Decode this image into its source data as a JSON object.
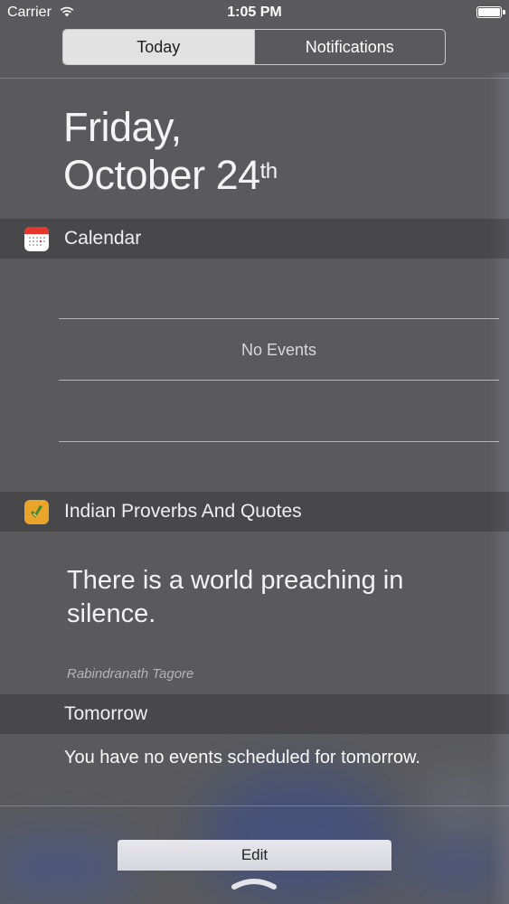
{
  "status_bar": {
    "carrier": "Carrier",
    "time": "1:05 PM"
  },
  "tabs": {
    "today": "Today",
    "notifications": "Notifications",
    "selected": "Today"
  },
  "date": {
    "weekday": "Friday,",
    "month_day": "October 24",
    "ordinal": "th"
  },
  "calendar_widget": {
    "title": "Calendar",
    "icon": "calendar-icon",
    "no_events": "No Events"
  },
  "proverbs_widget": {
    "title": "Indian Proverbs And Quotes",
    "icon": "proverbs-app-icon",
    "quote": "There is a world preaching in silence.",
    "author": "Rabindranath Tagore"
  },
  "tomorrow": {
    "title": "Tomorrow",
    "summary": "You have no events scheduled for tomorrow."
  },
  "footer": {
    "edit_label": "Edit",
    "grabber_icon": "chevron-grabber-icon"
  },
  "colors": {
    "background": "#5a5a5d",
    "segment_active": "#e2e2e2",
    "calendar_red": "#e8362d",
    "proverbs_orange": "#e8a52a"
  }
}
